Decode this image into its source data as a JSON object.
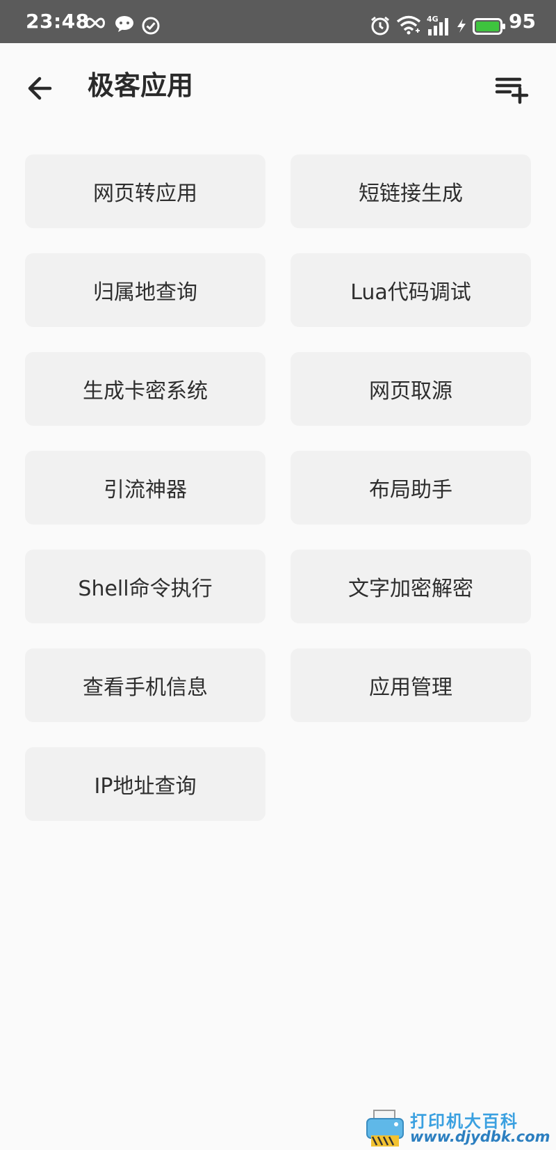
{
  "status_bar": {
    "time": "23:48",
    "network_label": "4G",
    "battery_percent": "95",
    "icons": [
      "infinity-icon",
      "wechat-icon",
      "check-circle-icon",
      "alarm-icon",
      "wifi-icon",
      "signal-icon",
      "charging-icon",
      "battery-icon"
    ],
    "battery_color": "#3ec43e"
  },
  "app_bar": {
    "title": "极客应用",
    "back_icon": "arrow-left-icon",
    "action_icon": "playlist-add-icon"
  },
  "tools": [
    {
      "label": "网页转应用"
    },
    {
      "label": "短链接生成"
    },
    {
      "label": "归属地查询"
    },
    {
      "label": "Lua代码调试"
    },
    {
      "label": "生成卡密系统"
    },
    {
      "label": "网页取源"
    },
    {
      "label": "引流神器"
    },
    {
      "label": "布局助手"
    },
    {
      "label": "Shell命令执行"
    },
    {
      "label": "文字加密解密"
    },
    {
      "label": "查看手机信息"
    },
    {
      "label": "应用管理"
    },
    {
      "label": "IP地址查询"
    }
  ],
  "watermark": {
    "line1": "打印机大百科",
    "line2": "www.djydbk.com"
  }
}
